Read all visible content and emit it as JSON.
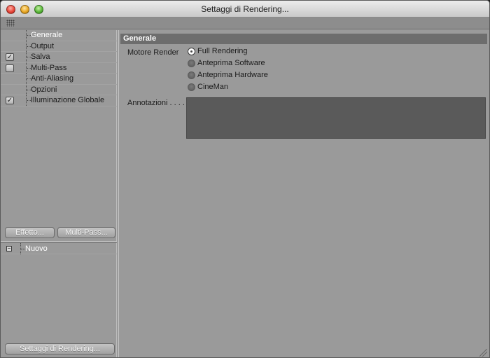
{
  "window": {
    "title": "Settaggi di Rendering..."
  },
  "sidebar": {
    "items": [
      {
        "label": "Generale",
        "checkbox": null,
        "selected": true
      },
      {
        "label": "Output",
        "checkbox": null,
        "selected": false
      },
      {
        "label": "Salva",
        "checkbox": "checked",
        "selected": false
      },
      {
        "label": "Multi-Pass",
        "checkbox": "unchecked",
        "selected": false
      },
      {
        "label": "Anti-Aliasing",
        "checkbox": null,
        "selected": false
      },
      {
        "label": "Opzioni",
        "checkbox": null,
        "selected": false
      },
      {
        "label": "Illuminazione Globale",
        "checkbox": "checked",
        "selected": false
      }
    ],
    "effetto_button": "Effetto...",
    "multipass_button": "Multi-Pass...",
    "list": [
      {
        "label": "Nuovo",
        "expander": "−"
      }
    ],
    "settaggi_button": "Settaggi di Rendering..."
  },
  "main": {
    "section_title": "Generale",
    "motore_label": "Motore Render",
    "render_options": [
      {
        "label": "Full Rendering",
        "checked": true
      },
      {
        "label": "Anteprima Software",
        "checked": false
      },
      {
        "label": "Anteprima Hardware",
        "checked": false
      },
      {
        "label": "CineMan",
        "checked": false
      }
    ],
    "annotazioni_label": "Annotazioni . . . .",
    "annotazioni_value": ""
  },
  "icons": {
    "check": "✓"
  }
}
